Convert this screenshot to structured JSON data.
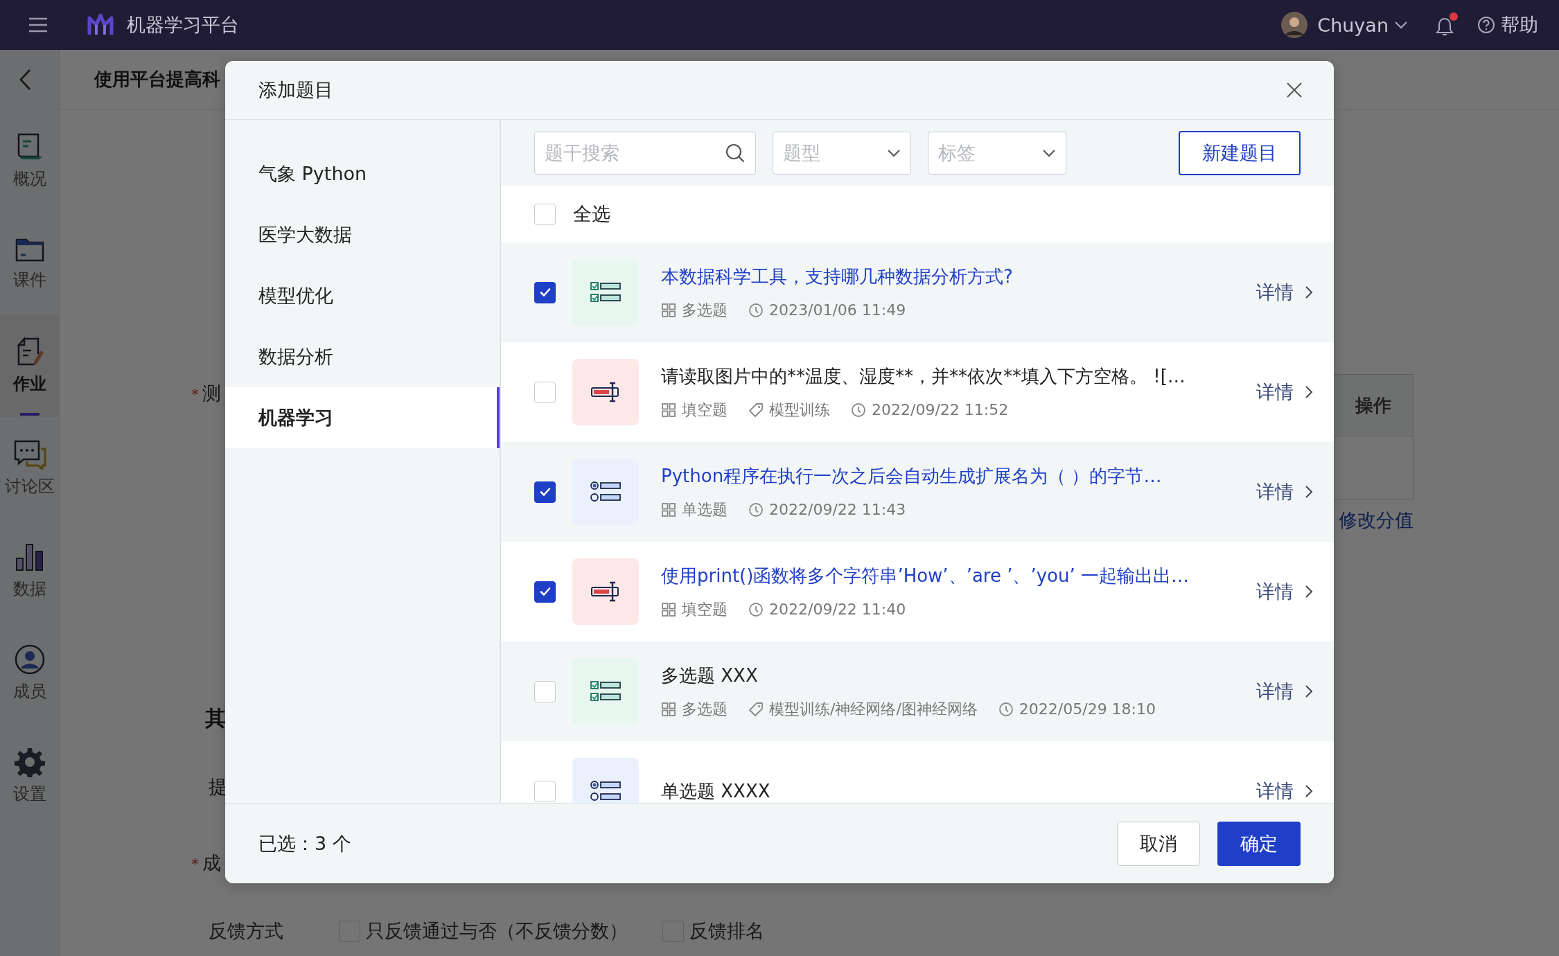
{
  "top_bar": {
    "app_title": "机器学习平台",
    "user": "Chuyan",
    "notification_unread": true,
    "help": "帮助"
  },
  "sidebar": {
    "items": [
      {
        "label": "概况",
        "selected": false
      },
      {
        "label": "课件",
        "selected": false
      },
      {
        "label": "作业",
        "selected": true
      },
      {
        "label": "讨论区",
        "selected": false
      },
      {
        "label": "数据",
        "selected": false
      },
      {
        "label": "成员",
        "selected": false
      },
      {
        "label": "设置",
        "selected": false
      }
    ]
  },
  "page": {
    "title": "使用平台提高科",
    "required_label": {
      "mark": "*",
      "text": "测"
    },
    "table_header": "操作",
    "link": "修改分值",
    "section_heading": "其",
    "label_2": "提",
    "required_label_2": {
      "mark": "*",
      "text": "成"
    },
    "feedback": {
      "label": "反馈方式",
      "options": [
        {
          "label": "只反馈通过与否（不反馈分数）",
          "checked": false
        },
        {
          "label": "反馈排名",
          "checked": false
        }
      ]
    }
  },
  "dialog": {
    "title": "添加题目",
    "categories": [
      {
        "label": "气象 Python",
        "selected": false
      },
      {
        "label": "医学大数据",
        "selected": false
      },
      {
        "label": "模型优化",
        "selected": false
      },
      {
        "label": "数据分析",
        "selected": false
      },
      {
        "label": "机器学习",
        "selected": true
      }
    ],
    "search": {
      "placeholder": "题干搜索"
    },
    "type_filter": {
      "placeholder": "题型"
    },
    "tag_filter": {
      "placeholder": "标签"
    },
    "new_button": "新建题目",
    "select_all": {
      "label": "全选",
      "checked": false
    },
    "questions": [
      {
        "kind": "multiple",
        "checked": true,
        "title": "本数据科学工具，支持哪几种数据分析方式?",
        "type": "多选题",
        "time": "2023/01/06 11:49",
        "detail": "详情"
      },
      {
        "kind": "fill",
        "checked": false,
        "title": "请读取图片中的**温度、湿度**，并**依次**填入下方空格。 ![…",
        "type": "填空题",
        "tag": "模型训练",
        "time": "2022/09/22 11:52",
        "detail": "详情"
      },
      {
        "kind": "single",
        "checked": true,
        "title": "Python程序在执行一次之后会自动生成扩展名为（ ）的字节…",
        "type": "单选题",
        "time": "2022/09/22 11:43",
        "detail": "详情"
      },
      {
        "kind": "fill",
        "checked": true,
        "title": "使用print()函数将多个字符串’How’、’are ’、’you’ 一起输出出…",
        "type": "填空题",
        "time": "2022/09/22 11:40",
        "detail": "详情"
      },
      {
        "kind": "multiple",
        "checked": false,
        "title": "多选题 XXX",
        "type": "多选题",
        "tag": "模型训练/神经网络/图神经网络",
        "time": "2022/05/29 18:10",
        "detail": "详情"
      },
      {
        "kind": "single",
        "checked": false,
        "title": "单选题 XXXX",
        "detail": "详情"
      }
    ],
    "selected_count": "已选：3 个",
    "cancel": "取消",
    "confirm": "确定"
  }
}
